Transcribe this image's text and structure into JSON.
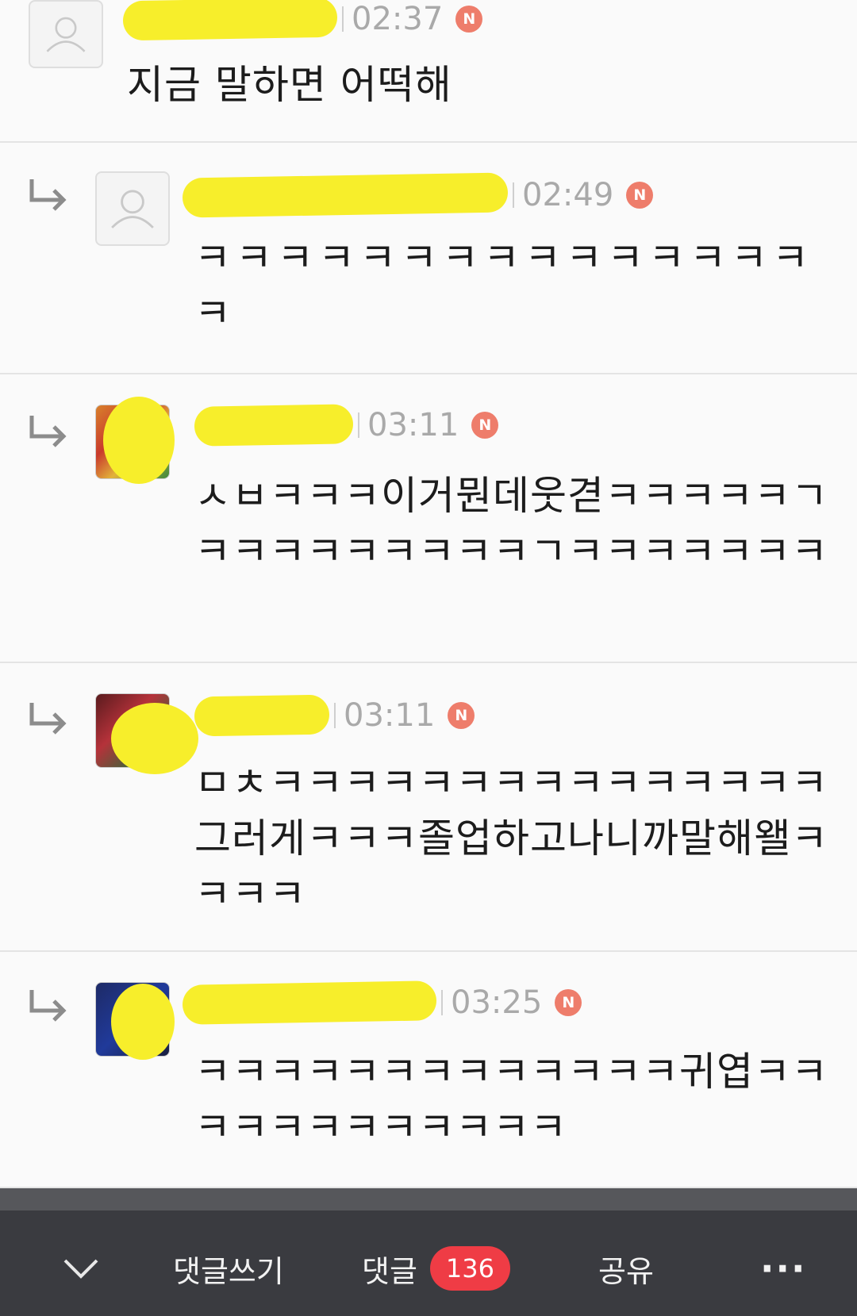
{
  "comments": [
    {
      "kind": "top",
      "name": "",
      "time": "02:37",
      "badge": "N",
      "text": "지금 말하면 어떡해",
      "avatar": "default"
    },
    {
      "kind": "reply",
      "name": "",
      "time": "02:49",
      "badge": "N",
      "text": "ㅋㅋㅋㅋㅋㅋㅋㅋㅋㅋㅋㅋㅋㅋㅋ ㅋ",
      "avatar": "default"
    },
    {
      "kind": "reply",
      "name": "",
      "time": "03:11",
      "badge": "N",
      "text": "ㅅㅂㅋㅋㅋ이거뭔데웃겯ㅋㅋㅋㅋㅋㄱㅋㅋㅋㅋㅋㅋㅋㅋㅋㄱㅋㅋㅋㅋㅋㅋㅋ",
      "avatar": "photo"
    },
    {
      "kind": "reply",
      "name": "",
      "time": "03:11",
      "badge": "N",
      "text": "ㅁㅊㅋㅋㅋㅋㅋㅋㅋㅋㅋㅋㅋㅋㅋㅋㅋ그러게ㅋㅋㅋ졸업하고나니까말해왤ㅋㅋㅋㅋ",
      "avatar": "photo"
    },
    {
      "kind": "reply",
      "name": "",
      "time": "03:25",
      "badge": "N",
      "text": "ㅋㅋㅋㅋㅋㅋㅋㅋㅋㅋㅋㅋㅋ귀엽ㅋㅋㅋㅋㅋㅋㅋㅋㅋㅋㅋㅋ",
      "avatar": "photo"
    }
  ],
  "bottom_bar": {
    "collapse_icon": "chevron-down-icon",
    "write_label": "댓글쓰기",
    "comments_label": "댓글",
    "comments_count": "136",
    "share_label": "공유",
    "more_label": "···"
  },
  "colors": {
    "redaction": "#f7ee2b",
    "new_badge": "#ee7d6b",
    "count_badge": "#ef3c45",
    "bar": "#3a3b40"
  }
}
